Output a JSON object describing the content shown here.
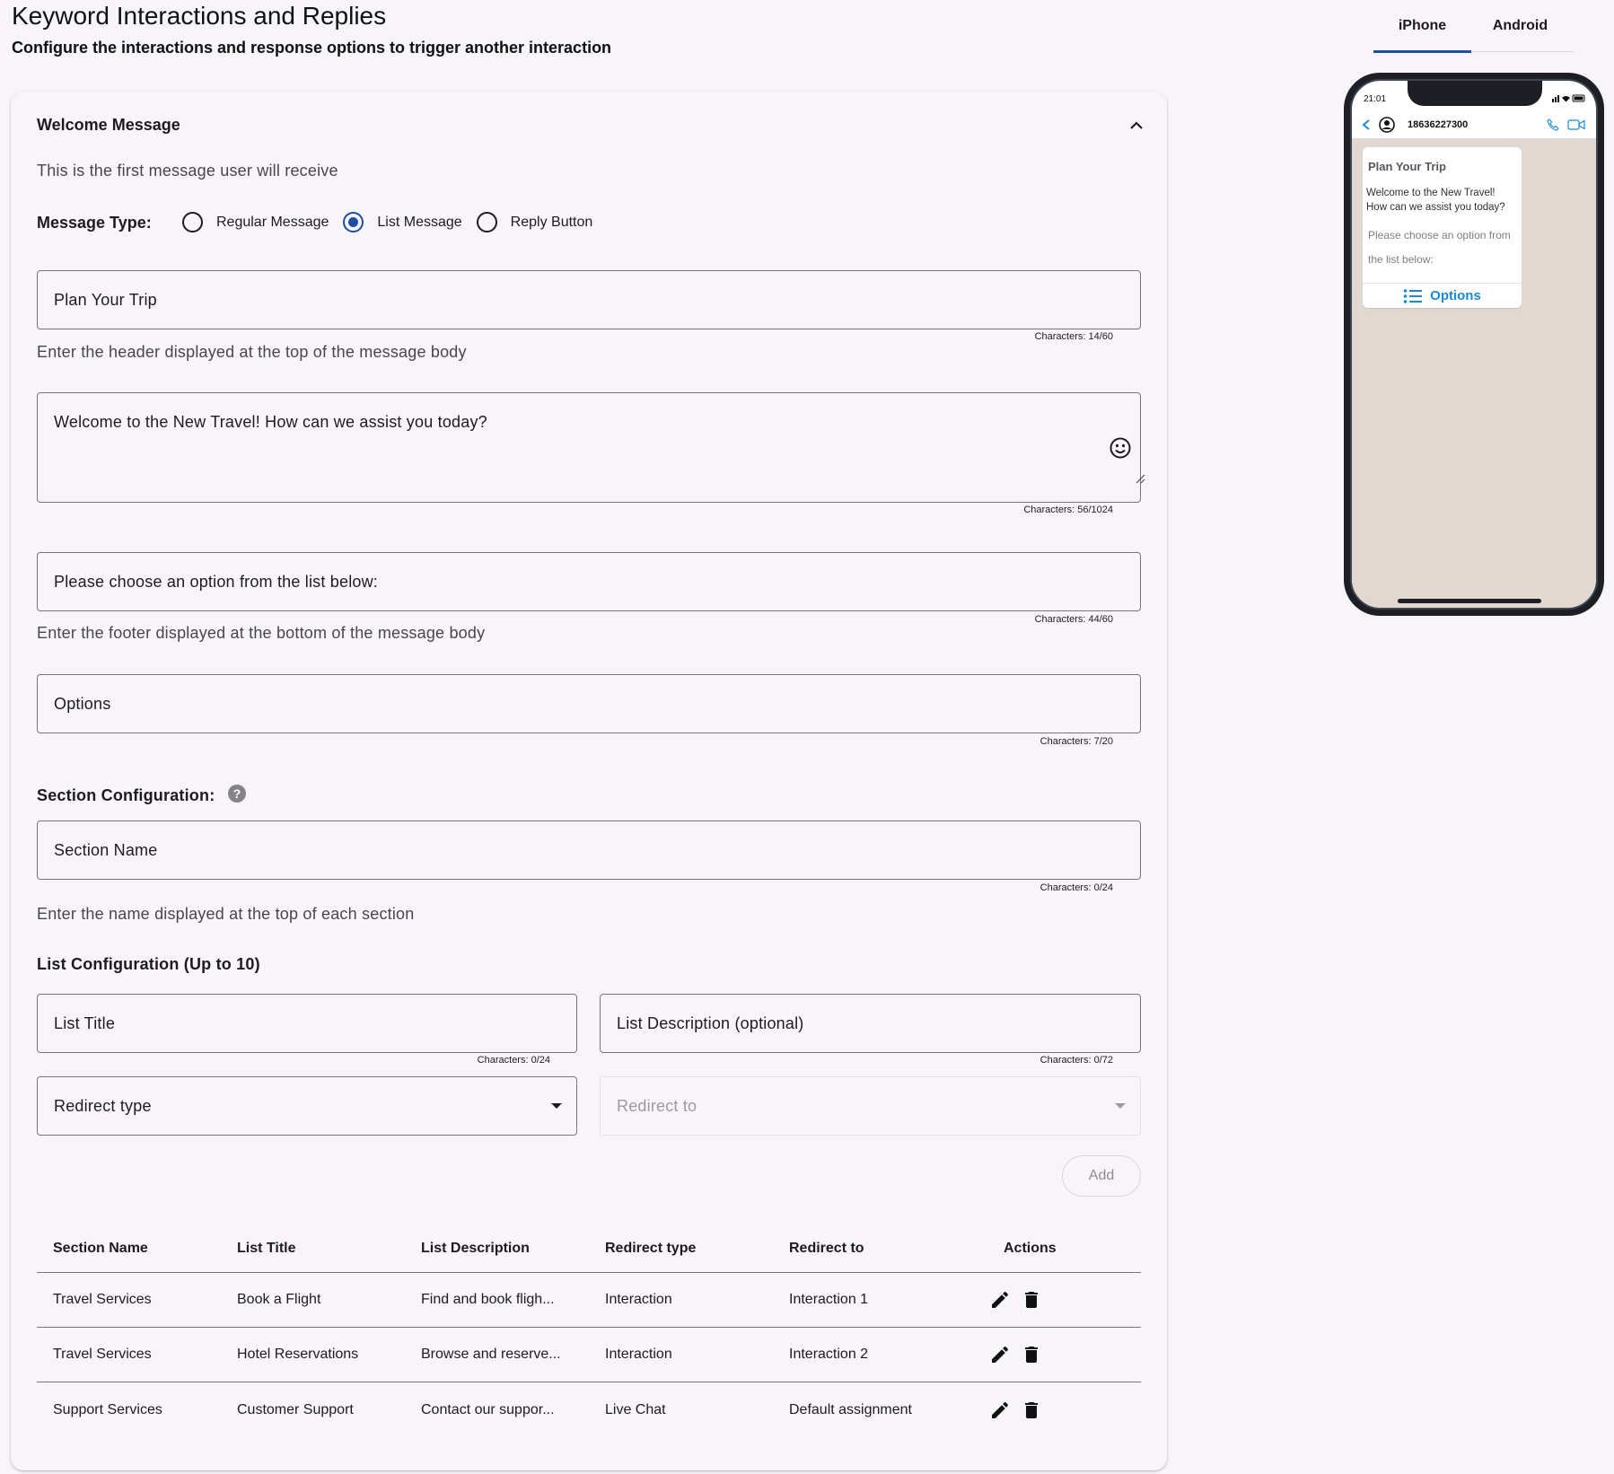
{
  "page": {
    "title": "Keyword Interactions and Replies",
    "subtitle": "Configure the interactions and response options to trigger another interaction"
  },
  "card": {
    "title": "Welcome Message",
    "description": "This is the first message user will receive",
    "collapse_icon": "chevron-up-icon"
  },
  "message_type": {
    "label": "Message Type:",
    "options": [
      "Regular Message",
      "List Message",
      "Reply Button"
    ],
    "selected": "List Message"
  },
  "header_field": {
    "value": "Plan Your Trip",
    "counter": "Characters: 14/60",
    "helper": "Enter the header displayed at the top of the message body"
  },
  "body_field": {
    "value": "Welcome to the New Travel!  How can we assist you today?",
    "counter": "Characters: 56/1024",
    "emoji_icon": "smiley-face-icon"
  },
  "footer_field": {
    "value": "Please choose an option from the list below:",
    "counter": "Characters: 44/60",
    "helper": "Enter the footer displayed at the bottom of the message body"
  },
  "button_field": {
    "value": "Options",
    "counter": "Characters: 7/20"
  },
  "section_config": {
    "label": "Section Configuration:",
    "help_icon": "question-mark-icon",
    "placeholder": "Section Name",
    "counter": "Characters: 0/24",
    "helper": "Enter the name displayed at the top of each section"
  },
  "list_config": {
    "label": "List Configuration (Up to 10)",
    "title_placeholder": "List Title",
    "title_counter": "Characters: 0/24",
    "desc_placeholder": "List Description (optional)",
    "desc_counter": "Characters: 0/72",
    "redirect_type_placeholder": "Redirect type",
    "redirect_to_placeholder": "Redirect to",
    "add_label": "Add"
  },
  "table": {
    "headers": [
      "Section Name",
      "List Title",
      "List Description",
      "Redirect type",
      "Redirect to",
      "Actions"
    ],
    "rows": [
      [
        "Travel Services",
        "Book a Flight",
        "Find and book fligh...",
        "Interaction",
        "Interaction 1"
      ],
      [
        "Travel Services",
        "Hotel Reservations",
        "Browse and reserve...",
        "Interaction",
        "Interaction 2"
      ],
      [
        "Support Services",
        "Customer Support",
        "Contact our suppor...",
        "Live Chat",
        "Default assignment"
      ]
    ],
    "action_icons": [
      "pencil-icon",
      "trash-icon"
    ]
  },
  "preview": {
    "tabs": [
      "iPhone",
      "Android"
    ],
    "active_tab": "iPhone",
    "status_time": "21:01",
    "phone_number": "18636227300",
    "bubble_header": "Plan Your Trip",
    "bubble_body": "Welcome to the New Travel!  How can we assist you today?",
    "bubble_footer": "Please choose an option from the list below:",
    "bubble_button": "Options"
  },
  "colors": {
    "accent": "#1d4ea6",
    "background": "#f7f5fa",
    "chat_background": "#e1d9d1",
    "link_blue": "#1a8ad0"
  }
}
